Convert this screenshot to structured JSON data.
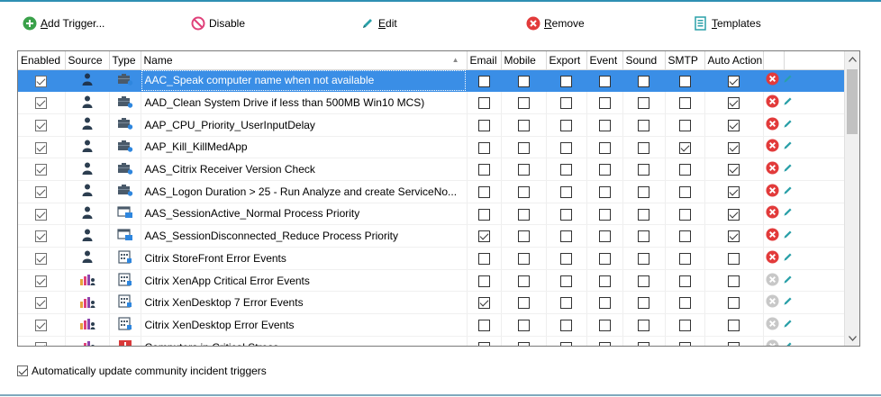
{
  "toolbar": {
    "add_label_ul": "A",
    "add_label_rest": "dd Trigger...",
    "disable_label": "Disable",
    "edit_label_ul": "E",
    "edit_label_rest": "dit",
    "remove_label_ul": "R",
    "remove_label_rest": "emove",
    "templates_label_ul": "T",
    "templates_label_rest": "emplates"
  },
  "columns": [
    "Enabled",
    "Source",
    "Type",
    "Name",
    "Email",
    "Mobile",
    "Export",
    "Event",
    "Sound",
    "SMTP",
    "Auto Action",
    "",
    ""
  ],
  "rows": [
    {
      "enabled": true,
      "source": "user-icon",
      "type": "computer-icon",
      "name": "AAC_Speak computer name when not available",
      "email": false,
      "mobile": false,
      "export": false,
      "event": false,
      "sound": false,
      "smtp": false,
      "auto_action": true,
      "removable": true,
      "selected": true
    },
    {
      "enabled": true,
      "source": "user-icon",
      "type": "computer-icon",
      "name": "AAD_Clean System Drive if less than 500MB Win10 MCS)",
      "email": false,
      "mobile": false,
      "export": false,
      "event": false,
      "sound": false,
      "smtp": false,
      "auto_action": true,
      "removable": true,
      "selected": false
    },
    {
      "enabled": true,
      "source": "user-icon",
      "type": "computer-icon",
      "name": "AAP_CPU_Priority_UserInputDelay",
      "email": false,
      "mobile": false,
      "export": false,
      "event": false,
      "sound": false,
      "smtp": false,
      "auto_action": true,
      "removable": true,
      "selected": false
    },
    {
      "enabled": true,
      "source": "user-icon",
      "type": "computer-icon",
      "name": "AAP_Kill_KillMedApp",
      "email": false,
      "mobile": false,
      "export": false,
      "event": false,
      "sound": false,
      "smtp": true,
      "auto_action": true,
      "removable": true,
      "selected": false
    },
    {
      "enabled": true,
      "source": "user-icon",
      "type": "computer-icon",
      "name": "AAS_Citrix Receiver Version Check",
      "email": false,
      "mobile": false,
      "export": false,
      "event": false,
      "sound": false,
      "smtp": false,
      "auto_action": true,
      "removable": true,
      "selected": false
    },
    {
      "enabled": true,
      "source": "user-icon",
      "type": "computer-icon",
      "name": "AAS_Logon Duration > 25 - Run Analyze and create ServiceNo...",
      "email": false,
      "mobile": false,
      "export": false,
      "event": false,
      "sound": false,
      "smtp": false,
      "auto_action": true,
      "removable": true,
      "selected": false
    },
    {
      "enabled": true,
      "source": "user-icon",
      "type": "session-icon",
      "name": "AAS_SessionActive_Normal Process Priority",
      "email": false,
      "mobile": false,
      "export": false,
      "event": false,
      "sound": false,
      "smtp": false,
      "auto_action": true,
      "removable": true,
      "selected": false
    },
    {
      "enabled": true,
      "source": "user-icon",
      "type": "session-icon",
      "name": "AAS_SessionDisconnected_Reduce Process Priority",
      "email": true,
      "mobile": false,
      "export": false,
      "event": false,
      "sound": false,
      "smtp": false,
      "auto_action": true,
      "removable": true,
      "selected": false
    },
    {
      "enabled": true,
      "source": "user-icon",
      "type": "event-log-icon",
      "name": "Citrix StoreFront Error Events",
      "email": false,
      "mobile": false,
      "export": false,
      "event": false,
      "sound": false,
      "smtp": false,
      "auto_action": false,
      "removable": true,
      "selected": false
    },
    {
      "enabled": true,
      "source": "community-icon",
      "type": "event-log-icon",
      "name": "Citrix XenApp Critical Error Events",
      "email": false,
      "mobile": false,
      "export": false,
      "event": false,
      "sound": false,
      "smtp": false,
      "auto_action": false,
      "removable": false,
      "selected": false
    },
    {
      "enabled": true,
      "source": "community-icon",
      "type": "event-log-icon",
      "name": "Citrix XenDesktop 7 Error Events",
      "email": true,
      "mobile": false,
      "export": false,
      "event": false,
      "sound": false,
      "smtp": false,
      "auto_action": false,
      "removable": false,
      "selected": false
    },
    {
      "enabled": true,
      "source": "community-icon",
      "type": "event-log-icon",
      "name": "Citrix XenDesktop Error Events",
      "email": false,
      "mobile": false,
      "export": false,
      "event": false,
      "sound": false,
      "smtp": false,
      "auto_action": false,
      "removable": false,
      "selected": false
    },
    {
      "enabled": true,
      "source": "community-icon",
      "type": "alert-icon",
      "name": "Computers in Critical Stress",
      "email": false,
      "mobile": false,
      "export": false,
      "event": false,
      "sound": false,
      "smtp": false,
      "auto_action": false,
      "removable": false,
      "selected": false
    }
  ],
  "footer": {
    "auto_update_label": "Automatically update community incident triggers",
    "auto_update_checked": true
  },
  "colors": {
    "accent": "#2e8fb3",
    "selection": "#3a8ee6",
    "remove_red": "#e23b3b",
    "remove_gray": "#c8c8c8",
    "edit_teal": "#2aa0a8",
    "add_green": "#3aa14a"
  }
}
